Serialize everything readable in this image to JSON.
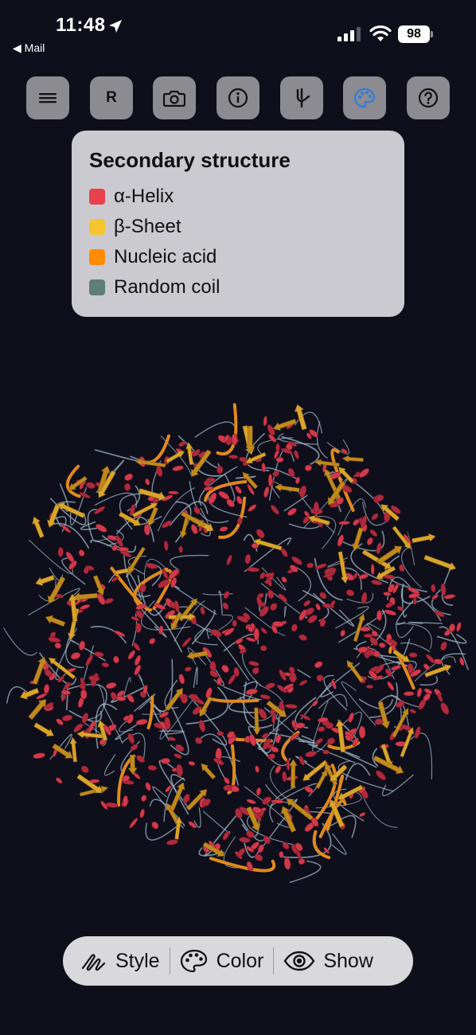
{
  "status_bar": {
    "time": "11:48",
    "back_label": "◀ Mail",
    "battery": "98"
  },
  "toolbar": {
    "buttons": [
      {
        "icon": "hamburger-menu-icon"
      },
      {
        "icon": "r-icon",
        "label": "R"
      },
      {
        "icon": "camera-icon"
      },
      {
        "icon": "info-icon"
      },
      {
        "icon": "tuning-fork-icon"
      },
      {
        "icon": "palette-icon",
        "active": true
      },
      {
        "icon": "help-icon"
      }
    ]
  },
  "legend": {
    "title": "Secondary structure",
    "items": [
      {
        "label": "α-Helix",
        "color": "#e8414e"
      },
      {
        "label": "β-Sheet",
        "color": "#f7c431"
      },
      {
        "label": "Nucleic acid",
        "color": "#ff8b00"
      },
      {
        "label": "Random coil",
        "color": "#5f7e76"
      }
    ]
  },
  "bottom_bar": {
    "style_label": "Style",
    "color_label": "Color",
    "show_label": "Show"
  },
  "colors": {
    "background": "#0f0e1b",
    "helix": "#d23a4c",
    "sheet": "#d9a52a",
    "nucleic": "#e08a1f",
    "coil": "#9fb7c6",
    "active_icon": "#2f7bd8"
  }
}
